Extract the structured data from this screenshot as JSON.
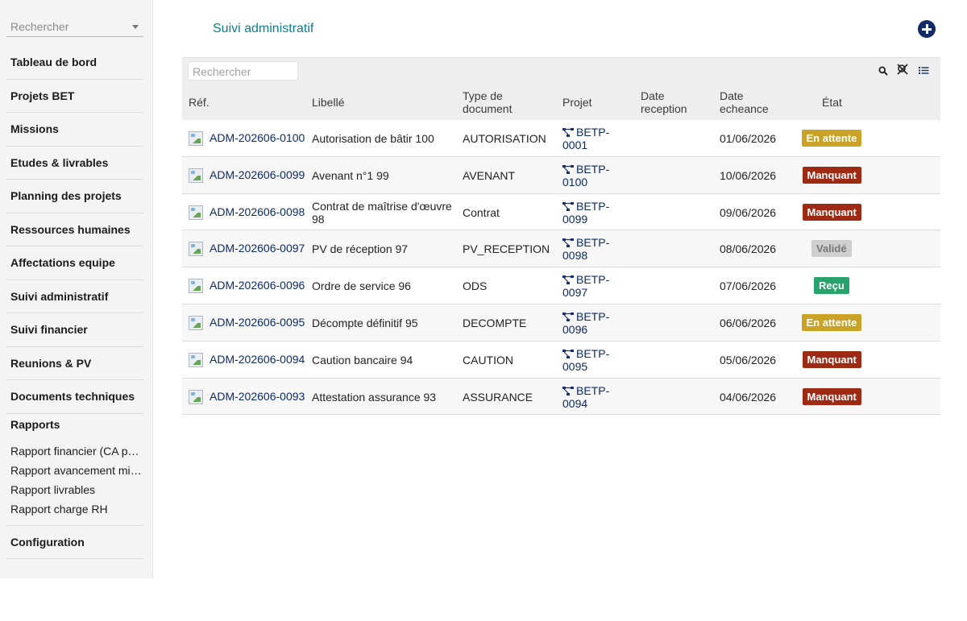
{
  "sidebar": {
    "search_placeholder": "Rechercher",
    "items": [
      {
        "label": "Tableau de bord"
      },
      {
        "label": "Projets BET"
      },
      {
        "label": "Missions"
      },
      {
        "label": "Etudes & livrables"
      },
      {
        "label": "Planning des projets"
      },
      {
        "label": "Ressources humaines"
      },
      {
        "label": "Affectations equipe"
      },
      {
        "label": "Suivi administratif"
      },
      {
        "label": "Suivi financier"
      },
      {
        "label": "Reunions & PV"
      },
      {
        "label": "Documents techniques"
      }
    ],
    "reports": {
      "label": "Rapports",
      "items": [
        {
          "label": "Rapport financier (CA par…"
        },
        {
          "label": "Rapport avancement mis…"
        },
        {
          "label": "Rapport livrables"
        },
        {
          "label": "Rapport charge RH"
        }
      ]
    },
    "config_label": "Configuration"
  },
  "header": {
    "title": "Suivi administratif",
    "add_icon": "plus-circle-icon"
  },
  "table": {
    "search_placeholder": "Rechercher",
    "toolbar_icons": [
      "search-icon",
      "filter-off-icon",
      "list-icon"
    ],
    "columns": {
      "ref": "Réf.",
      "libelle": "Libellé",
      "type_1": "Type de",
      "type_2": "document",
      "projet": "Projet",
      "reception_1": "Date",
      "reception_2": "reception",
      "echeance_1": "Date",
      "echeance_2": "echeance",
      "etat": "État"
    },
    "status_colors": {
      "En attente": "#c9a227",
      "Manquant": "#9e2a14",
      "Validé": "#cfcfcf",
      "Reçu": "#27a36b"
    },
    "rows": [
      {
        "ref": "ADM-202606-0100",
        "libelle_1": "Autorisation de bâtir 100",
        "libelle_2": "",
        "type": "AUTORISATION",
        "proj_1": "BETP-",
        "proj_2": "0001",
        "reception": "",
        "echeance": "01/06/2026",
        "etat": "En attente"
      },
      {
        "ref": "ADM-202606-0099",
        "libelle_1": "Avenant n°1 99",
        "libelle_2": "",
        "type": "AVENANT",
        "proj_1": "BETP-",
        "proj_2": "0100",
        "reception": "",
        "echeance": "10/06/2026",
        "etat": "Manquant"
      },
      {
        "ref": "ADM-202606-0098",
        "libelle_1": "Contrat de maîtrise d'œuvre",
        "libelle_2": "98",
        "type": "Contrat",
        "proj_1": "BETP-",
        "proj_2": "0099",
        "reception": "",
        "echeance": "09/06/2026",
        "etat": "Manquant"
      },
      {
        "ref": "ADM-202606-0097",
        "libelle_1": "PV de réception 97",
        "libelle_2": "",
        "type": "PV_RECEPTION",
        "proj_1": "BETP-",
        "proj_2": "0098",
        "reception": "",
        "echeance": "08/06/2026",
        "etat": "Validé"
      },
      {
        "ref": "ADM-202606-0096",
        "libelle_1": "Ordre de service 96",
        "libelle_2": "",
        "type": "ODS",
        "proj_1": "BETP-",
        "proj_2": "0097",
        "reception": "",
        "echeance": "07/06/2026",
        "etat": "Reçu"
      },
      {
        "ref": "ADM-202606-0095",
        "libelle_1": "Décompte définitif 95",
        "libelle_2": "",
        "type": "DECOMPTE",
        "proj_1": "BETP-",
        "proj_2": "0096",
        "reception": "",
        "echeance": "06/06/2026",
        "etat": "En attente"
      },
      {
        "ref": "ADM-202606-0094",
        "libelle_1": "Caution bancaire 94",
        "libelle_2": "",
        "type": "CAUTION",
        "proj_1": "BETP-",
        "proj_2": "0095",
        "reception": "",
        "echeance": "05/06/2026",
        "etat": "Manquant"
      },
      {
        "ref": "ADM-202606-0093",
        "libelle_1": "Attestation assurance 93",
        "libelle_2": "",
        "type": "ASSURANCE",
        "proj_1": "BETP-",
        "proj_2": "0094",
        "reception": "",
        "echeance": "04/06/2026",
        "etat": "Manquant"
      }
    ]
  }
}
